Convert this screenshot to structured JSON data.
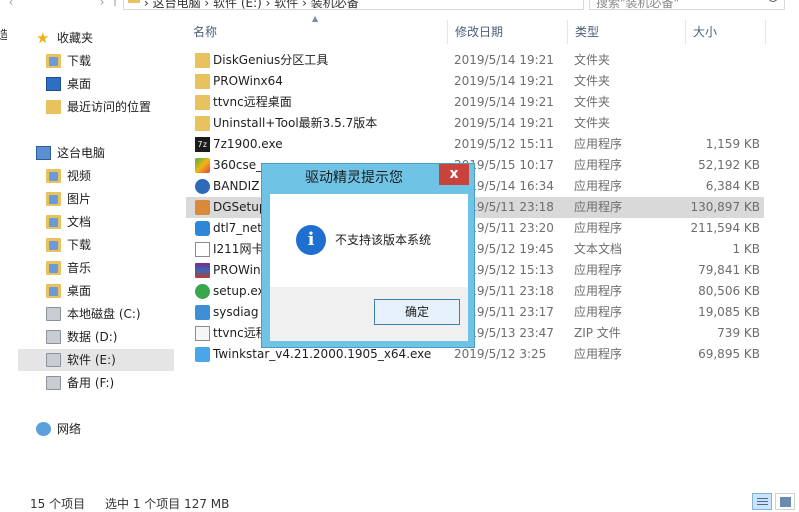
{
  "address": {
    "crumbs": "› 这台电脑 › 软件 (E:) › 软件 › 装机必备"
  },
  "search": {
    "placeholder": "搜索\"装机必备\""
  },
  "edge_text": "造",
  "nav": {
    "items": [
      {
        "label": "收藏夹",
        "icon": "star-icon",
        "name": "nav-favorites"
      },
      {
        "label": "下载",
        "icon": "download-folder-icon",
        "name": "nav-downloads"
      },
      {
        "label": "桌面",
        "icon": "desktop-icon",
        "name": "nav-desktop"
      },
      {
        "label": "最近访问的位置",
        "icon": "recent-places-icon",
        "name": "nav-recent"
      },
      {
        "label": "这台电脑",
        "icon": "computer-icon",
        "name": "nav-this-pc"
      },
      {
        "label": "视频",
        "icon": "video-folder-icon",
        "name": "nav-videos"
      },
      {
        "label": "图片",
        "icon": "pictures-folder-icon",
        "name": "nav-pictures"
      },
      {
        "label": "文档",
        "icon": "documents-folder-icon",
        "name": "nav-documents"
      },
      {
        "label": "下载",
        "icon": "download-folder-icon",
        "name": "nav-downloads-2"
      },
      {
        "label": "音乐",
        "icon": "music-folder-icon",
        "name": "nav-music"
      },
      {
        "label": "桌面",
        "icon": "desktop-folder-icon",
        "name": "nav-desktop-2"
      },
      {
        "label": "本地磁盘 (C:)",
        "icon": "drive-icon",
        "name": "nav-drive-c"
      },
      {
        "label": "数据 (D:)",
        "icon": "drive-icon",
        "name": "nav-drive-d"
      },
      {
        "label": "软件 (E:)",
        "icon": "drive-icon",
        "name": "nav-drive-e",
        "selected": true
      },
      {
        "label": "备用 (F:)",
        "icon": "drive-icon",
        "name": "nav-drive-f"
      },
      {
        "label": "网络",
        "icon": "network-icon",
        "name": "nav-network"
      }
    ]
  },
  "columns": {
    "name": "名称",
    "date": "修改日期",
    "type": "类型",
    "size": "大小"
  },
  "files": [
    {
      "name": "DiskGenius分区工具",
      "date": "2019/5/14 19:21",
      "type": "文件夹",
      "size": "",
      "icon": "folder-icon"
    },
    {
      "name": "PROWinx64",
      "date": "2019/5/14 19:21",
      "type": "文件夹",
      "size": "",
      "icon": "folder-icon"
    },
    {
      "name": "ttvnc远程桌面",
      "date": "2019/5/14 19:21",
      "type": "文件夹",
      "size": "",
      "icon": "folder-icon"
    },
    {
      "name": "Uninstall+Tool最新3.5.7版本",
      "date": "2019/5/14 19:21",
      "type": "文件夹",
      "size": "",
      "icon": "folder-icon"
    },
    {
      "name": "7z1900.exe",
      "date": "2019/5/12 15:11",
      "type": "应用程序",
      "size": "1,159 KB",
      "icon": "7zip-icon"
    },
    {
      "name": "360cse_",
      "date": "2019/5/15 10:17",
      "type": "应用程序",
      "size": "52,192 KB",
      "icon": "360-browser-icon"
    },
    {
      "name": "BANDIZ",
      "date": "2019/5/14 16:34",
      "type": "应用程序",
      "size": "6,384 KB",
      "icon": "bandizip-icon"
    },
    {
      "name": "DGSetup",
      "date": "2019/5/11 23:18",
      "type": "应用程序",
      "size": "130,897 KB",
      "icon": "diskgenius-icon",
      "selected": true
    },
    {
      "name": "dtl7_net",
      "date": "2019/5/11 23:20",
      "type": "应用程序",
      "size": "211,594 KB",
      "icon": "driver-app-icon"
    },
    {
      "name": "I211网卡",
      "date": "2019/5/12 19:45",
      "type": "文本文档",
      "size": "1 KB",
      "icon": "text-file-icon"
    },
    {
      "name": "PROWin",
      "date": "2019/5/12 15:13",
      "type": "应用程序",
      "size": "79,841 KB",
      "icon": "winrar-icon"
    },
    {
      "name": "setup.ex",
      "date": "2019/5/11 23:18",
      "type": "应用程序",
      "size": "80,506 KB",
      "icon": "setup-icon"
    },
    {
      "name": "sysdiag",
      "date": "2019/5/11 23:17",
      "type": "应用程序",
      "size": "19,085 KB",
      "icon": "sysdiag-icon"
    },
    {
      "name": "ttvnc远程",
      "date": "2019/5/13 23:47",
      "type": "ZIP 文件",
      "size": "739 KB",
      "icon": "zip-file-icon"
    },
    {
      "name": "Twinkstar_v4.21.2000.1905_x64.exe",
      "date": "2019/5/12 3:25",
      "type": "应用程序",
      "size": "69,895 KB",
      "icon": "twinkstar-icon"
    }
  ],
  "dialog": {
    "title": "驱动精灵提示您",
    "close": "x",
    "message": "不支持该版本系统",
    "ok": "确定",
    "info_glyph": "i"
  },
  "status": {
    "count": "15 个项目",
    "selected": "选中 1 个项目 127 MB"
  },
  "colors": {
    "dialog_frame": "#6fc4e6",
    "close_button": "#c9433c",
    "info_icon": "#1f6fd0",
    "selection": "#d9d9d9"
  }
}
